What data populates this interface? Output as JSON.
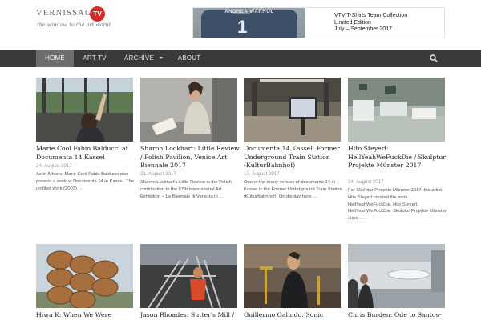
{
  "header": {
    "logo_word": "VERNISSAGE",
    "logo_badge": "TV",
    "logo_tagline": "the window to the art world",
    "banner": {
      "shirt_name": "ANDREA WARHOL",
      "shirt_number": "1",
      "line1": "VTV T-Shirts Team Collection",
      "line2": "Limited Edition",
      "line3": "July – September 2017"
    }
  },
  "nav": {
    "items": [
      {
        "label": "HOME"
      },
      {
        "label": "ART TV"
      },
      {
        "label": "ARCHIVE"
      },
      {
        "label": "ABOUT"
      }
    ],
    "search_icon": "search-icon"
  },
  "posts": [
    {
      "title": "Marie Cool Fabio Balducci at Documenta 14 Kassel",
      "date": "24. August 2017",
      "excerpt": "As in Athens, Marie Cool Fabio Balducci also present a work at Documenta 14 in Kassel. The untitled work (2003) …"
    },
    {
      "title": "Sharon Lockhart: Little Review / Polish Pavilion, Venice Art Biennale 2017",
      "date": "21. August 2017",
      "excerpt": "Sharon Lockhart's Little Review is the Polish contribution to the 57th International Art Exhibition – La Biennale di Venezia in …"
    },
    {
      "title": "Documenta 14 Kassel: Former Underground Train Station (KulturBahnhof)",
      "date": "17. August 2017",
      "excerpt": "One of the many venues of documenta 14 in Kassel is the Former Underground Train Station (KulturBahnhof). On display here …"
    },
    {
      "title": "Hito Steyerl: HellYeahWeFuckDie / Skulptur Projekte Münster 2017",
      "date": "14. August 2017",
      "excerpt": "For Skulptur Projekte Münster 2017, the artist Hito Steyerl created the work HellYeahWeFuckDie. Hito Steyerl: HellYeahWeFuckDie. Skulptur Projekte Münster, June …"
    },
    {
      "title": "Hiwa K: When We Were"
    },
    {
      "title": "Jason Rhoades: Sutter's Mill /"
    },
    {
      "title": "Guillermo Galindo: Sonic"
    },
    {
      "title": "Chris Burden: Ode to Santos-"
    }
  ]
}
